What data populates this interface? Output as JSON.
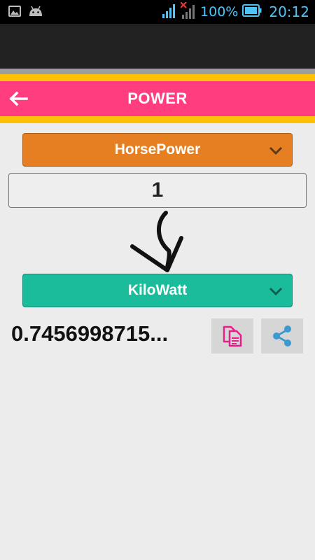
{
  "status_bar": {
    "battery_text": "100%",
    "time": "20:12"
  },
  "header": {
    "title": "POWER",
    "back_icon": "arrow-left-icon"
  },
  "converter": {
    "from_unit": "HorsePower",
    "input_value": "1",
    "to_unit": "KiloWatt",
    "result": "0.7456998715..."
  },
  "actions": {
    "copy_icon": "copy-icon",
    "share_icon": "share-icon"
  },
  "colors": {
    "title_bar": "#ff3d7f",
    "accent_yellow": "#ffc107",
    "from_dropdown": "#e67e22",
    "to_dropdown": "#1abc9c",
    "copy_icon": "#e91e8c",
    "share_icon": "#3d9ad1",
    "status_icons": "#4fc3f7"
  }
}
